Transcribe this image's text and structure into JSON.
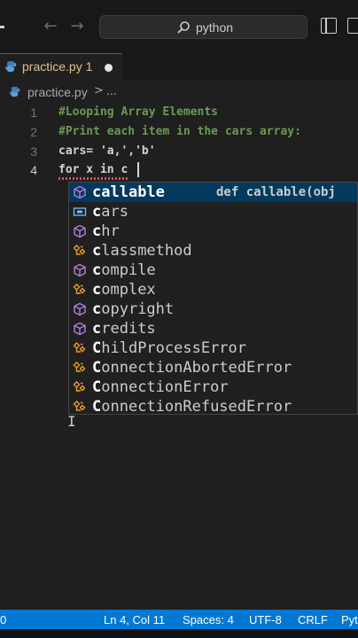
{
  "titlebar": {
    "back_icon": "arrow-left-icon",
    "forward_icon": "arrow-right-icon",
    "search_text": "python"
  },
  "tab": {
    "label": "practice.py 1",
    "modified": true
  },
  "breadcrumb": {
    "file": "practice.py",
    "separator": ">",
    "more": "..."
  },
  "editor": {
    "lines": [
      {
        "number": "1",
        "text": "#Looping Array Elements",
        "kind": "comment"
      },
      {
        "number": "2",
        "text": "#Print each item in the cars array:",
        "kind": "comment"
      },
      {
        "number": "3",
        "text": "cars= 'a,','b'",
        "kind": "plain"
      },
      {
        "number": "4",
        "text": "for x in c",
        "kind": "plain"
      }
    ]
  },
  "suggestions": {
    "detail": "def callable(obj",
    "items": [
      {
        "match": "c",
        "rest": "allable",
        "icon": "cube-icon",
        "selected": true
      },
      {
        "match": "c",
        "rest": "ars",
        "icon": "variable-icon",
        "selected": false
      },
      {
        "match": "c",
        "rest": "hr",
        "icon": "cube-icon",
        "selected": false
      },
      {
        "match": "c",
        "rest": "lassmethod",
        "icon": "class-icon",
        "selected": false
      },
      {
        "match": "c",
        "rest": "ompile",
        "icon": "cube-icon",
        "selected": false
      },
      {
        "match": "c",
        "rest": "omplex",
        "icon": "class-icon",
        "selected": false
      },
      {
        "match": "c",
        "rest": "opyright",
        "icon": "cube-icon",
        "selected": false
      },
      {
        "match": "c",
        "rest": "redits",
        "icon": "cube-icon",
        "selected": false
      },
      {
        "match": "C",
        "rest": "hildProcessError",
        "icon": "class-icon",
        "selected": false
      },
      {
        "match": "C",
        "rest": "onnectionAbortedError",
        "icon": "class-icon",
        "selected": false
      },
      {
        "match": "C",
        "rest": "onnectionError",
        "icon": "class-icon",
        "selected": false
      },
      {
        "match": "C",
        "rest": "onnectionRefusedError",
        "icon": "class-icon",
        "selected": false
      }
    ]
  },
  "statusbar": {
    "problems": "0",
    "position": "Ln 4, Col 11",
    "spaces": "Spaces: 4",
    "encoding": "UTF-8",
    "eol": "CRLF",
    "language": "Pyt"
  },
  "colors": {
    "accent": "#0078d4",
    "comment": "#6a9955",
    "tab_label": "#e2c08d",
    "class_icon": "#ee9d28",
    "method_icon": "#b180d7",
    "variable_icon": "#75beff"
  }
}
